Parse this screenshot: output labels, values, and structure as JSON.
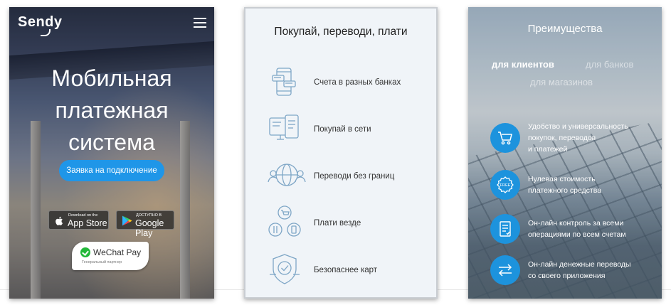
{
  "card1": {
    "logo": "Sendy",
    "hero_title_lines": [
      "Мобильная",
      "платежная",
      "система"
    ],
    "cta_label": "Заявка на подключение",
    "appstore": {
      "sub": "Download on the",
      "main": "App Store"
    },
    "googleplay": {
      "sub": "ДОСТУПНО В",
      "main": "Google Play"
    },
    "wechat": {
      "name": "WeChat Pay",
      "sub": "Генеральный партнер"
    }
  },
  "card2": {
    "title": "Покупай, переводи, плати",
    "features": [
      {
        "label": "Счета в разных банках",
        "icon": "phone-cards-icon"
      },
      {
        "label": "Покупай в сети",
        "icon": "online-shop-icon"
      },
      {
        "label": "Переводи без границ",
        "icon": "globe-users-icon"
      },
      {
        "label": "Плати везде",
        "icon": "pay-anywhere-icon"
      },
      {
        "label": "Безопаснее карт",
        "icon": "shield-check-icon"
      }
    ]
  },
  "card3": {
    "title": "Преимущества",
    "tabs": {
      "clients": "для клиентов",
      "banks": "для банков",
      "stores": "для магазинов"
    },
    "benefits": [
      {
        "lines": [
          "Удобство и универсальность",
          "покупок, переводов",
          "и платежей"
        ],
        "icon": "cart-icon"
      },
      {
        "lines": [
          "Нулевая стоимость",
          "платежного средства"
        ],
        "icon": "free-badge-icon",
        "badge": "FREE"
      },
      {
        "lines": [
          "Он-лайн контроль за всеми",
          "операциями по всем счетам"
        ],
        "icon": "document-icon"
      },
      {
        "lines": [
          "Он-лайн денежные переводы",
          "со своего приложения"
        ],
        "icon": "transfer-arrows-icon"
      }
    ]
  },
  "colors": {
    "accent": "#1f96e8",
    "benefit_circle": "#1d93dd",
    "card2_bg": "#f0f4f8",
    "icon_stroke": "#7ea6c6"
  }
}
